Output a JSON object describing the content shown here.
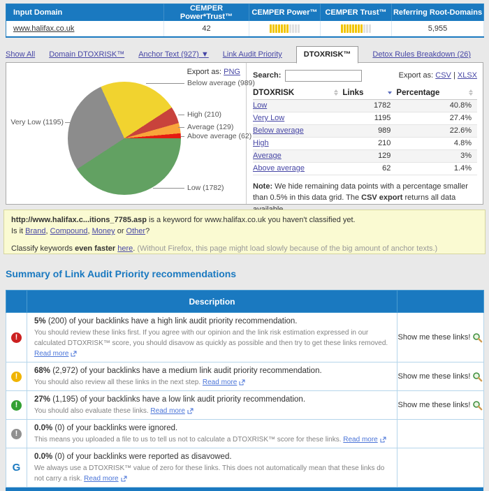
{
  "colors": {
    "header_blue": "#1a79c0",
    "page_bg": "#e9e9e9",
    "bar_filled": "#f2c500",
    "bar_empty": "#e0e0e0",
    "link": "#4646a5",
    "notice_bg": "#fafad2"
  },
  "top_table": {
    "headers": [
      "Input Domain",
      "CEMPER Power*Trust™",
      "CEMPER Power™",
      "CEMPER Trust™",
      "Referring Root-Domains"
    ],
    "row": {
      "domain": "www.halifax.co.uk",
      "power_trust": "42",
      "power_bar": {
        "filled": 7,
        "total": 11
      },
      "trust_bar": {
        "filled": 8,
        "total": 11
      },
      "referring_root_domains": "5,955"
    }
  },
  "tabs": [
    {
      "label": "Show All"
    },
    {
      "label": "Domain DTOXRISK™"
    },
    {
      "label": "Anchor Text (927) ▼"
    },
    {
      "label": "Link Audit Priority"
    },
    {
      "label": "DTOXRISK™",
      "active": true
    },
    {
      "label": "Detox Rules Breakdown (26)"
    }
  ],
  "pie_panel": {
    "export_label": "Export as:",
    "export_link": "PNG"
  },
  "chart_data": {
    "type": "pie",
    "start": "east-clockwise",
    "legend_position": "callouts",
    "slices": [
      {
        "label": "Low",
        "value": 1782,
        "percentage": "40.8%",
        "color": "#62a162",
        "callout": "Low (1782)"
      },
      {
        "label": "Very Low",
        "value": 1195,
        "percentage": "27.4%",
        "color": "#8c8c8c",
        "callout": "Very Low (1195)"
      },
      {
        "label": "Below average",
        "value": 989,
        "percentage": "22.6%",
        "color": "#f1d32f",
        "callout": "Below average (989)"
      },
      {
        "label": "High",
        "value": 210,
        "percentage": "4.8%",
        "color": "#c8423c",
        "callout": "High (210)"
      },
      {
        "label": "Average",
        "value": 129,
        "percentage": "3%",
        "color": "#f9a43b",
        "callout": "Average (129)"
      },
      {
        "label": "Above average",
        "value": 62,
        "percentage": "1.4%",
        "color": "#e41b12",
        "callout": "Above average (62)"
      }
    ]
  },
  "grid_panel": {
    "search": {
      "label": "Search:",
      "value": ""
    },
    "export": {
      "label": "Export as:",
      "csv": "CSV",
      "sep": "|",
      "xlsx": "XLSX"
    },
    "columns": [
      "DTOXRISK",
      "Links",
      "Percentage"
    ],
    "sorted_by": "Links descending",
    "rows": [
      {
        "risk": "Low",
        "links": "1782",
        "percentage": "40.8%"
      },
      {
        "risk": "Very Low",
        "links": "1195",
        "percentage": "27.4%"
      },
      {
        "risk": "Below average",
        "links": "989",
        "percentage": "22.6%"
      },
      {
        "risk": "High",
        "links": "210",
        "percentage": "4.8%"
      },
      {
        "risk": "Average",
        "links": "129",
        "percentage": "3%"
      },
      {
        "risk": "Above average",
        "links": "62",
        "percentage": "1.4%"
      }
    ],
    "note": {
      "bold1": "Note:",
      "text1": " We hide remaining data points with a percentage smaller than 0.5% in this data grid. The ",
      "bold2": "CSV export",
      "text2": " returns all data available."
    }
  },
  "notice": {
    "keyword": "http://www.halifax.c...itions_7785.asp",
    "line1_rest": " is a keyword for www.halifax.co.uk you haven't classified yet.",
    "line2_prefix": "Is it ",
    "brand": "Brand",
    "comma1": ", ",
    "compound": "Compound",
    "comma2": ", ",
    "money": "Money",
    "or_word": " or ",
    "other": "Other",
    "qmark": "?",
    "line3_prefix": "Classify keywords ",
    "line3_bold": "even faster",
    "space": " ",
    "here": "here",
    "period": ". ",
    "line3_gray": "(Without Firefox, this page might load slowly because of the big amount of anchor texts.)"
  },
  "summary": {
    "heading": "Summary of Link Audit Priority recommendations",
    "description_header": "Description",
    "rows": [
      {
        "icon_glyph": "!",
        "icon_color": "#cc2020",
        "pct": "5%",
        "rest": " (200) of your backlinks have a high link audit priority recommendation.",
        "detail": "You should review these links first. If you agree with our opinion and the link risk estimation expressed in our calculated DTOXRISK™ score, you should disavow as quickly as possible and then try to get these links removed. ",
        "read_more": "Read more",
        "action": "Show me these links!"
      },
      {
        "icon_glyph": "!",
        "icon_color": "#f0b400",
        "pct": "68%",
        "rest": " (2,972) of your backlinks have a medium link audit priority recommendation.",
        "detail": "You should also review all these links in the next step. ",
        "read_more": "Read more",
        "action": "Show me these links!"
      },
      {
        "icon_glyph": "!",
        "icon_color": "#33a033",
        "pct": "27%",
        "rest": " (1,195) of your backlinks have a low link audit priority recommendation.",
        "detail": "You should also evaluate these links. ",
        "read_more": "Read more",
        "action": "Show me these links!"
      },
      {
        "icon_glyph": "!",
        "icon_color": "#909090",
        "pct": "0.0%",
        "rest": " (0) of your backlinks were ignored.",
        "detail": "This means you uploaded a file to us to tell us not to calculate a DTOXRISK™ score for these links. ",
        "read_more": "Read more"
      },
      {
        "icon_glyph": "G",
        "icon_color": "#1a79c0",
        "pct": "0.0%",
        "rest": " (0) of your backlinks were reported as disavowed.",
        "detail": "We always use a DTOXRISK™ value of zero for these links. This does not automatically mean that these links do not carry a risk. ",
        "read_more": "Read more"
      }
    ]
  }
}
